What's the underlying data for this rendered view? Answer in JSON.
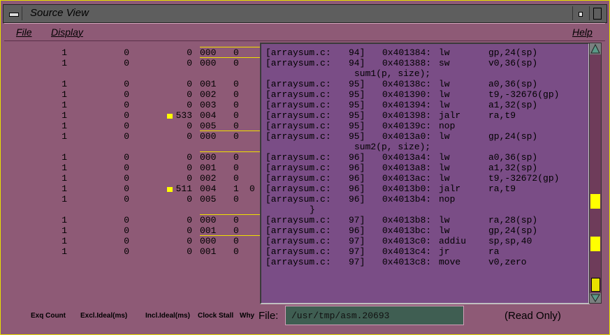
{
  "window": {
    "title": "Source View"
  },
  "menu": {
    "file": "File",
    "display": "Display",
    "help": "Help"
  },
  "perf_rows": [
    {
      "count": "1",
      "excl": "0",
      "incl": "0",
      "clock": "000",
      "stall": "0",
      "why": "",
      "marked": false
    },
    {
      "count": "1",
      "excl": "0",
      "incl": "0",
      "clock": "000",
      "stall": "0",
      "why": "",
      "marked": false
    },
    null,
    {
      "count": "1",
      "excl": "0",
      "incl": "0",
      "clock": "001",
      "stall": "0",
      "why": "",
      "marked": false
    },
    {
      "count": "1",
      "excl": "0",
      "incl": "0",
      "clock": "002",
      "stall": "0",
      "why": "",
      "marked": false
    },
    {
      "count": "1",
      "excl": "0",
      "incl": "0",
      "clock": "003",
      "stall": "0",
      "why": "",
      "marked": false
    },
    {
      "count": "1",
      "excl": "0",
      "incl": "533",
      "clock": "004",
      "stall": "0",
      "why": "",
      "marked": true
    },
    {
      "count": "1",
      "excl": "0",
      "incl": "0",
      "clock": "005",
      "stall": "0",
      "why": "",
      "marked": false
    },
    {
      "count": "1",
      "excl": "0",
      "incl": "0",
      "clock": "000",
      "stall": "0",
      "why": "",
      "marked": false
    },
    null,
    {
      "count": "1",
      "excl": "0",
      "incl": "0",
      "clock": "000",
      "stall": "0",
      "why": "",
      "marked": false
    },
    {
      "count": "1",
      "excl": "0",
      "incl": "0",
      "clock": "001",
      "stall": "0",
      "why": "",
      "marked": false
    },
    {
      "count": "1",
      "excl": "0",
      "incl": "0",
      "clock": "002",
      "stall": "0",
      "why": "",
      "marked": false
    },
    {
      "count": "1",
      "excl": "0",
      "incl": "511",
      "clock": "004",
      "stall": "1",
      "why": "0",
      "marked": true
    },
    {
      "count": "1",
      "excl": "0",
      "incl": "0",
      "clock": "005",
      "stall": "0",
      "why": "",
      "marked": false
    },
    null,
    {
      "count": "1",
      "excl": "0",
      "incl": "0",
      "clock": "000",
      "stall": "0",
      "why": "",
      "marked": false
    },
    {
      "count": "1",
      "excl": "0",
      "incl": "0",
      "clock": "001",
      "stall": "0",
      "why": "",
      "marked": false
    },
    {
      "count": "1",
      "excl": "0",
      "incl": "0",
      "clock": "000",
      "stall": "0",
      "why": "",
      "marked": false
    },
    {
      "count": "1",
      "excl": "0",
      "incl": "0",
      "clock": "001",
      "stall": "0",
      "why": "",
      "marked": false
    }
  ],
  "source_rows": [
    {
      "file": "[arraysum.c:",
      "line": "94]",
      "addr": "0x401384:",
      "op": "lw",
      "args": "gp,24(sp)"
    },
    {
      "file": "[arraysum.c:",
      "line": "94]",
      "addr": "0x401388:",
      "op": "sw",
      "args": "v0,36(sp)"
    },
    {
      "src": "sum1(p, size);",
      "indent": "wide"
    },
    {
      "file": "[arraysum.c:",
      "line": "95]",
      "addr": "0x40138c:",
      "op": "lw",
      "args": "a0,36(sp)"
    },
    {
      "file": "[arraysum.c:",
      "line": "95]",
      "addr": "0x401390:",
      "op": "lw",
      "args": "t9,-32676(gp)"
    },
    {
      "file": "[arraysum.c:",
      "line": "95]",
      "addr": "0x401394:",
      "op": "lw",
      "args": "a1,32(sp)"
    },
    {
      "file": "[arraysum.c:",
      "line": "95]",
      "addr": "0x401398:",
      "op": "jalr",
      "args": "ra,t9"
    },
    {
      "file": "[arraysum.c:",
      "line": "95]",
      "addr": "0x40139c:",
      "op": "nop",
      "args": ""
    },
    {
      "file": "[arraysum.c:",
      "line": "95]",
      "addr": "0x4013a0:",
      "op": "lw",
      "args": "gp,24(sp)"
    },
    {
      "src": "sum2(p, size);",
      "indent": "wide"
    },
    {
      "file": "[arraysum.c:",
      "line": "96]",
      "addr": "0x4013a4:",
      "op": "lw",
      "args": "a0,36(sp)"
    },
    {
      "file": "[arraysum.c:",
      "line": "96]",
      "addr": "0x4013a8:",
      "op": "lw",
      "args": "a1,32(sp)"
    },
    {
      "file": "[arraysum.c:",
      "line": "96]",
      "addr": "0x4013ac:",
      "op": "lw",
      "args": "t9,-32672(gp)"
    },
    {
      "file": "[arraysum.c:",
      "line": "96]",
      "addr": "0x4013b0:",
      "op": "jalr",
      "args": "ra,t9"
    },
    {
      "file": "[arraysum.c:",
      "line": "96]",
      "addr": "0x4013b4:",
      "op": "nop",
      "args": ""
    },
    {
      "src": "}",
      "indent": "narrow"
    },
    {
      "file": "[arraysum.c:",
      "line": "97]",
      "addr": "0x4013b8:",
      "op": "lw",
      "args": "ra,28(sp)"
    },
    {
      "file": "[arraysum.c:",
      "line": "96]",
      "addr": "0x4013bc:",
      "op": "lw",
      "args": "gp,24(sp)"
    },
    {
      "file": "[arraysum.c:",
      "line": "97]",
      "addr": "0x4013c0:",
      "op": "addiu",
      "args": "sp,sp,40"
    },
    {
      "file": "[arraysum.c:",
      "line": "97]",
      "addr": "0x4013c4:",
      "op": "jr",
      "args": "ra"
    },
    {
      "file": "[arraysum.c:",
      "line": "97]",
      "addr": "0x4013c8:",
      "op": "move",
      "args": "v0,zero"
    }
  ],
  "columns": {
    "exq_count": "Exq Count",
    "excl_ideal": "Excl.Ideal(ms)",
    "incl_ideal": "Incl.Ideal(ms)",
    "clock_stall": "Clock Stall",
    "why": "Why"
  },
  "file": {
    "label": "File:",
    "value": "/usr/tmp/asm.20693",
    "status": "(Read Only)"
  },
  "colors": {
    "background": "#8e5a76",
    "source_bg": "#7a4d86",
    "highlight": "#ffff00",
    "file_field": "#3f5e52"
  }
}
